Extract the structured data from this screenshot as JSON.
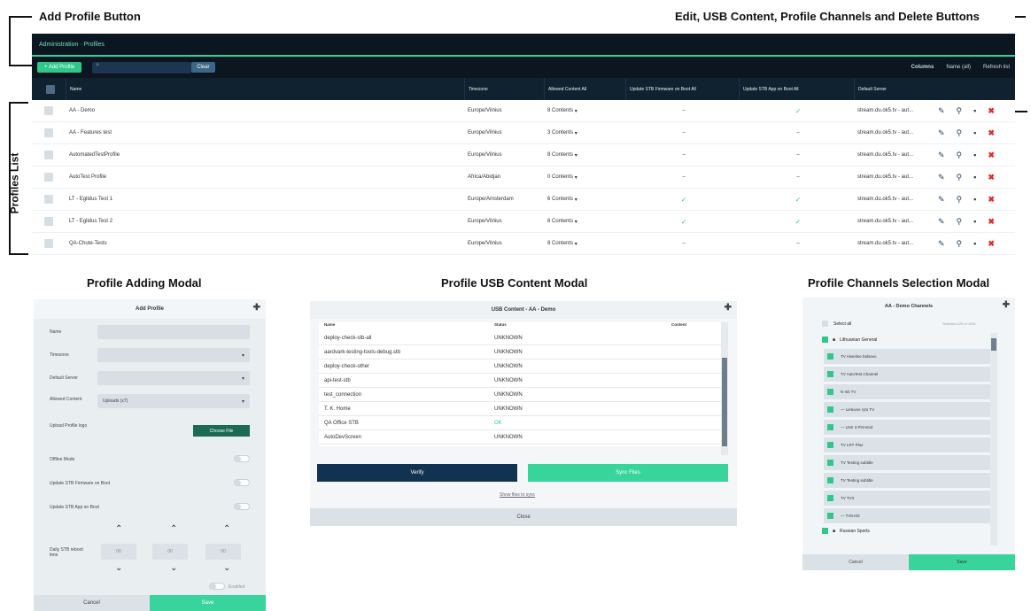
{
  "annotations": {
    "add_profile": "Add Profile Button",
    "actions": "Edit, USB Content, Profile Channels and Delete Buttons",
    "list": "Profiles List",
    "adding_modal": "Profile Adding Modal",
    "usb_modal": "Profile USB Content Modal",
    "channels_modal": "Profile Channels Selection Modal"
  },
  "topbar": {
    "breadcrumb": "Administration · Profiles"
  },
  "toolbar": {
    "add_label": "+ Add Profile",
    "clear_label": "Clear",
    "columns_label": "Columns",
    "columns_value": "Name (all)",
    "refresh_label": "Refresh list"
  },
  "table": {
    "headers": [
      "Name",
      "Timezone",
      "Allowed Content  All",
      "Update STB Firmware on Boot  All",
      "Update STB App on Boot  All",
      "Default Server"
    ],
    "rows": [
      {
        "name": "AA - Demo",
        "tz": "Europe/Vilnius",
        "content": "8 Contents",
        "fw": "–",
        "app": "✓",
        "server": "stream.du.ok5.tv - aut..."
      },
      {
        "name": "AA - Features test",
        "tz": "Europe/Vilnius",
        "content": "3 Contents",
        "fw": "–",
        "app": "–",
        "server": "stream.du.ok5.tv - aut..."
      },
      {
        "name": "AutomatedTestProfile",
        "tz": "Europe/Vilnius",
        "content": "8 Contents",
        "fw": "–",
        "app": "–",
        "server": "stream.du.ok5.tv - aut..."
      },
      {
        "name": "AutoTest Profile",
        "tz": "Africa/Abidjan",
        "content": "0 Contents",
        "fw": "–",
        "app": "–",
        "server": "stream.du.ok5.tv - aut..."
      },
      {
        "name": "LT - Eglidus Test 1",
        "tz": "Europe/Amsterdam",
        "content": "6 Contents",
        "fw": "✓",
        "app": "✓",
        "server": "stream.du.ok5.tv - aut..."
      },
      {
        "name": "LT - Eglidus Test 2",
        "tz": "Europe/Vilnius",
        "content": "6 Contents",
        "fw": "✓",
        "app": "✓",
        "server": "stream.du.ok5.tv - aut..."
      },
      {
        "name": "QA-Chute-Tests",
        "tz": "Europe/Vilnius",
        "content": "8 Contents",
        "fw": "–",
        "app": "–",
        "server": "stream.du.ok5.tv - aut..."
      }
    ]
  },
  "add_modal": {
    "title": "Add Profile",
    "labels": {
      "name": "Name",
      "timezone": "Timezone",
      "default_server": "Default Server",
      "allowed_content": "Allowed Content",
      "upload_logo": "Upload Profile logo",
      "offline": "Offline Mode",
      "fw_boot": "Update STB Firmware on Boot",
      "app_boot": "Update STB App on Boot",
      "reboot": "Daily STB reboot time",
      "enabled": "Enabled"
    },
    "allowed_value": "Uploads (x7)",
    "choose_file": "Choose File",
    "time": {
      "h": "00",
      "m": "00",
      "s": "00"
    },
    "cancel": "Cancel",
    "save": "Save"
  },
  "usb_modal": {
    "title": "USB Content - AA - Demo",
    "headers": {
      "name": "Name",
      "status": "Status",
      "content": "Content"
    },
    "rows": [
      {
        "name": "deploy-check-stb-all",
        "status": "UNKNOWN"
      },
      {
        "name": "aardvark-testing-tools-debug.stb",
        "status": "UNKNOWN"
      },
      {
        "name": "deploy-check-other",
        "status": "UNKNOWN"
      },
      {
        "name": "api-test-stb",
        "status": "UNKNOWN"
      },
      {
        "name": "test_connection",
        "status": "UNKNOWN"
      },
      {
        "name": "T. K. Home",
        "status": "UNKNOWN"
      },
      {
        "name": "QA Office STB",
        "status": "OK"
      },
      {
        "name": "AutoDevScreen",
        "status": "UNKNOWN"
      }
    ],
    "verify": "Verify",
    "sync": "Sync Files",
    "show_link": "Show files to sync",
    "close": "Close"
  },
  "channels_modal": {
    "title": "AA - Demo Channels",
    "select_all": "Select all",
    "selected": "Selected 129 of 1091",
    "group1": "Lithuanian General",
    "channels": [
      "TV  Akseline balsavo",
      "TV  AutoTest Channel",
      "N  Init TV",
      "— Lietuvos ryto TV",
      "— LNK 3 Pirmmid",
      "TV  LRT Plus",
      "TV  Testing subtitle",
      "TV  Testing subtitle",
      "TV  TV3",
      "— TV8.HD"
    ],
    "group2": "Russian Sports",
    "cancel": "Cancel",
    "save": "Save"
  }
}
